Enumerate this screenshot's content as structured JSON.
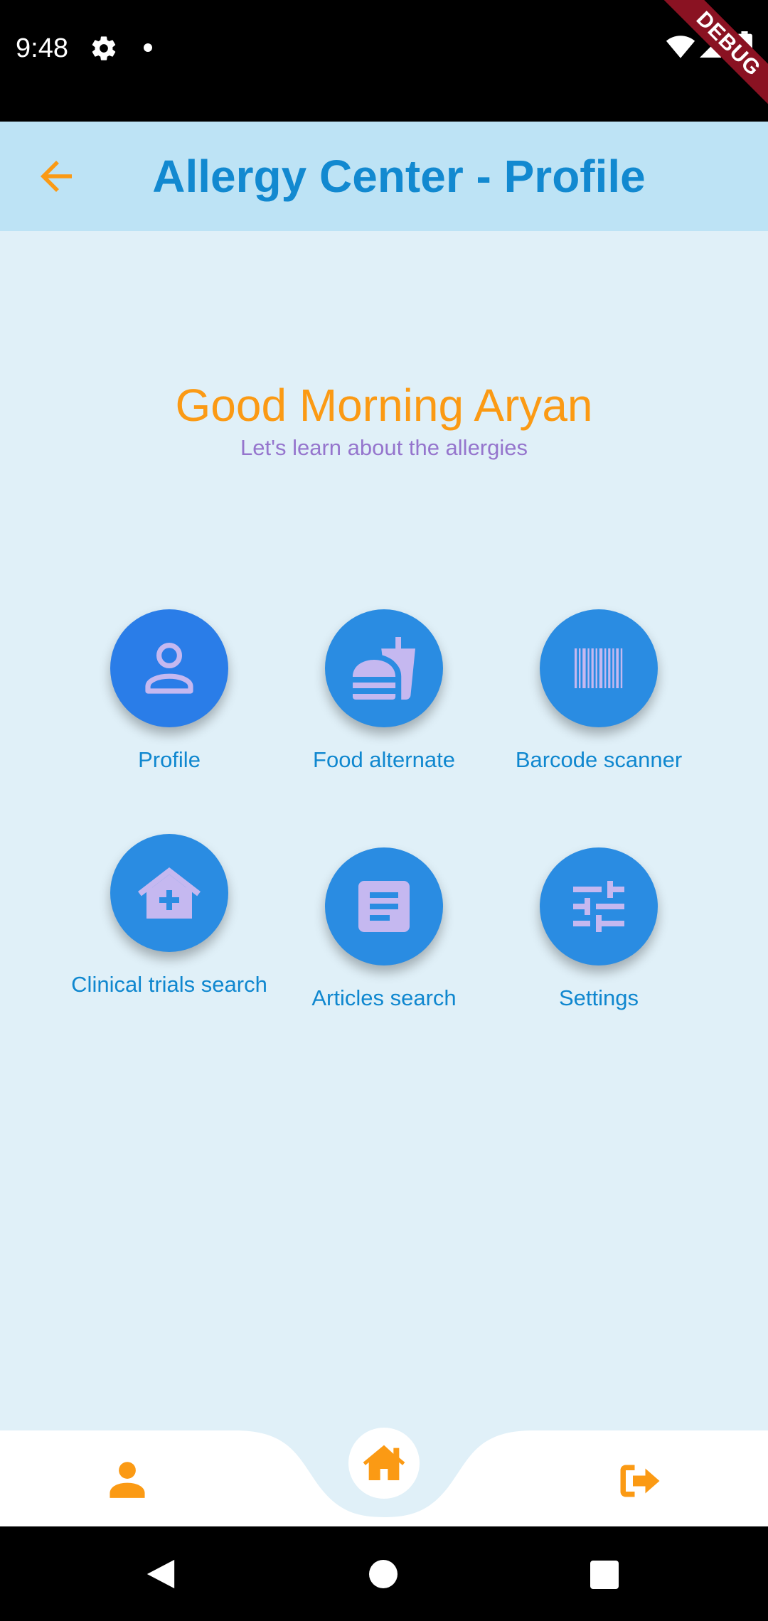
{
  "status_bar": {
    "time": "9:48",
    "icons": [
      "gear-icon",
      "notification-dot",
      "wifi-icon",
      "signal-icon",
      "battery-icon"
    ]
  },
  "debug_banner": "DEBUG",
  "app_bar": {
    "back_icon": "arrow-back-icon",
    "title": "Allergy Center - Profile"
  },
  "greeting": {
    "title": "Good Morning Aryan",
    "subtitle": "Let's learn about the allergies"
  },
  "tiles": [
    {
      "label": "Profile",
      "icon": "person-icon"
    },
    {
      "label": "Food alternate",
      "icon": "fastfood-icon"
    },
    {
      "label": "Barcode scanner",
      "icon": "barcode-icon"
    },
    {
      "label": "Clinical trials search",
      "icon": "hospital-icon"
    },
    {
      "label": "Articles search",
      "icon": "article-icon"
    },
    {
      "label": "Settings",
      "icon": "tune-icon"
    }
  ],
  "bottom_nav": {
    "items": [
      "person-icon",
      "home-icon",
      "logout-icon"
    ]
  },
  "colors": {
    "accent": "#fb9a14",
    "primary": "#1289d0",
    "app_bar": "#bde3f5",
    "background": "#e0f0f8",
    "tile": "#2a8ce2",
    "tile_icon": "#c5b8f0",
    "subtitle": "#9575cd"
  }
}
